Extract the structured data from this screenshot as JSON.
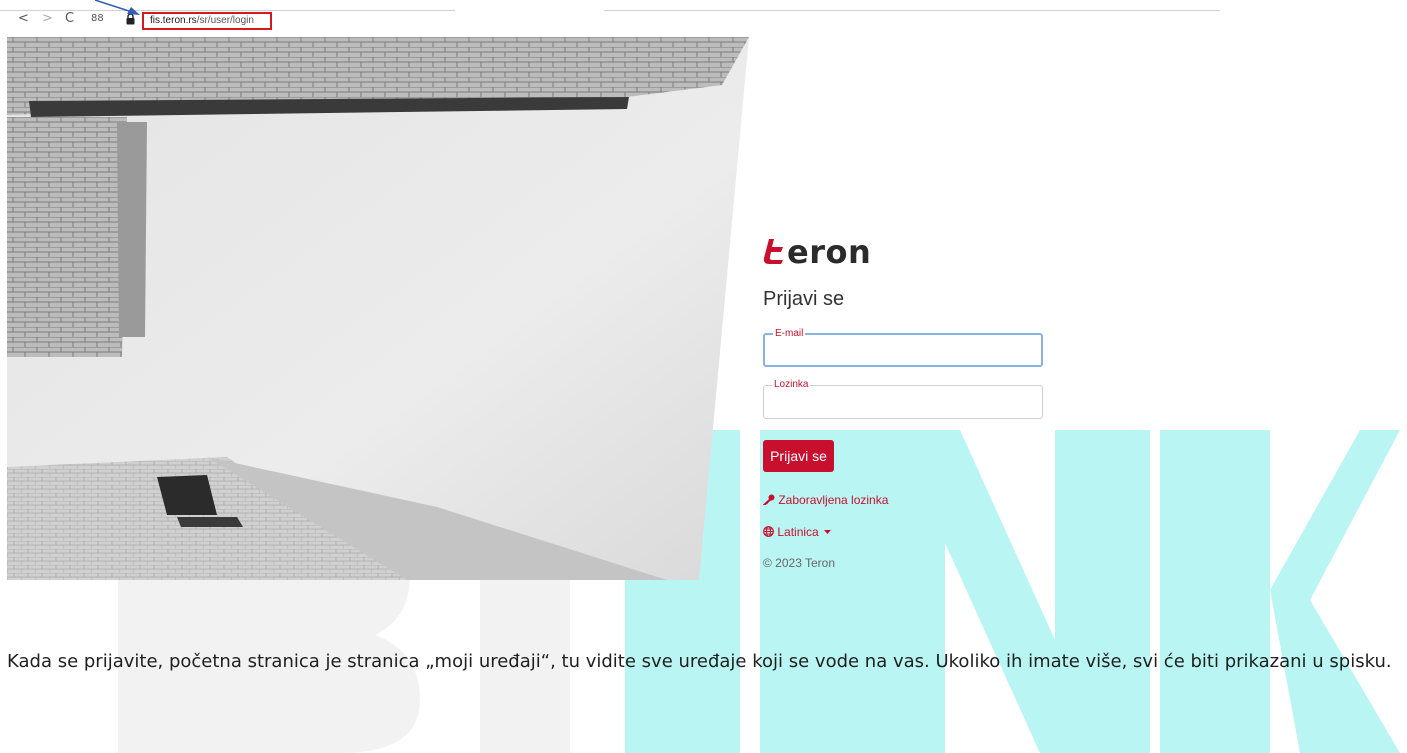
{
  "browser": {
    "nav_back": "<",
    "nav_forward": ">",
    "nav_reload": "C",
    "nav_apps": "88",
    "url_domain": "fis.teron.rs",
    "url_path": "/sr/user/login"
  },
  "login": {
    "logo_text": "eron",
    "title": "Prijavi se",
    "email_label": "E-mail",
    "password_label": "Lozinka",
    "submit_label": "Prijavi se",
    "forgot_label": "Zaboravljena lozinka",
    "language_label": "Latinica",
    "copyright": "© 2023 Teron"
  },
  "caption": {
    "line": "Kada se prijavite, početna stranica je stranica „moji uređaji“, tu vidite sve uređaje koji se vode na vas. Ukoliko ih imate više, svi će biti prikazani u spisku."
  },
  "colors": {
    "accent": "#c8102e",
    "highlight_box": "#d7191f",
    "pointer": "#2f5fb3",
    "watermark_cyan": "#b8f7f4",
    "watermark_gray": "#f0f0f0"
  },
  "icons": {
    "forgot": "key-icon",
    "language": "globe-icon",
    "caret": "caret-down-icon",
    "lock": "lock-icon"
  }
}
